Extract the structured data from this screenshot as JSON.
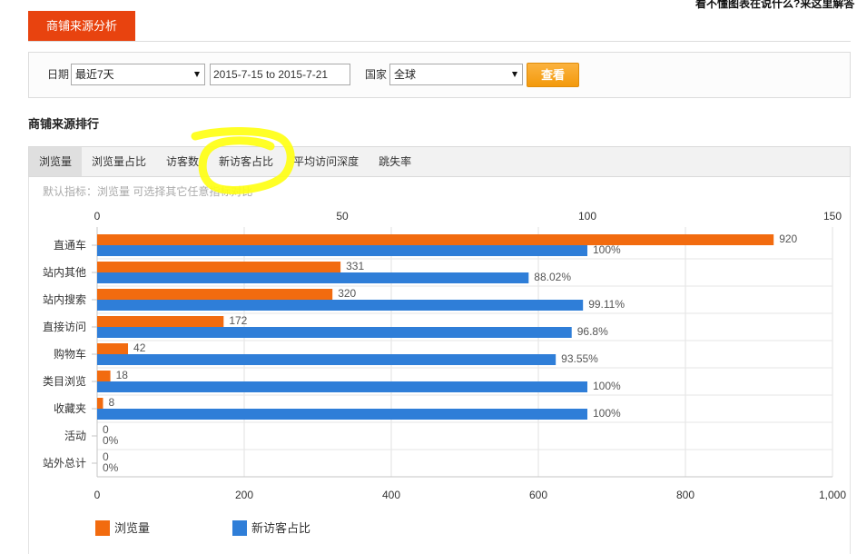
{
  "header": {
    "help_link": "看不懂图表在说什么?来这里解答",
    "tab_label": "商铺来源分析"
  },
  "filters": {
    "date_label": "日期",
    "date_range_select": "最近7天",
    "date_range_value": "2015-7-15 to 2015-7-21",
    "country_label": "国家",
    "country_select": "全球",
    "submit_label": "查看"
  },
  "section": {
    "title": "商铺来源排行",
    "hint": "默认指标：浏览量 可选择其它任意指标对比"
  },
  "metric_tabs": [
    {
      "label": "浏览量",
      "active": true
    },
    {
      "label": "浏览量占比",
      "active": false
    },
    {
      "label": "访客数",
      "active": false
    },
    {
      "label": "新访客占比",
      "active": false
    },
    {
      "label": "平均访问深度",
      "active": false
    },
    {
      "label": "跳失率",
      "active": false
    }
  ],
  "icons": {
    "select_caret": "caret-down-icon"
  },
  "colors": {
    "header_tab": "#e8430f",
    "submit_button": "#f7a41f",
    "annotation_highlight": "#ffff14"
  },
  "chart_data": {
    "type": "bar",
    "orientation": "horizontal",
    "categories": [
      "直通车",
      "站内其他",
      "站内搜索",
      "直接访问",
      "购物车",
      "类目浏览",
      "收藏夹",
      "活动",
      "站外总计"
    ],
    "series": [
      {
        "name": "浏览量",
        "axis": "bottom",
        "color": "#f26b0f",
        "values": [
          920,
          331,
          320,
          172,
          42,
          18,
          8,
          0,
          0
        ],
        "labels": [
          "920",
          "331",
          "320",
          "172",
          "42",
          "18",
          "8",
          "0",
          "0"
        ]
      },
      {
        "name": "新访客占比",
        "axis": "top",
        "color": "#2f7ed8",
        "values": [
          100,
          88.02,
          99.11,
          96.8,
          93.55,
          100,
          100,
          0,
          0
        ],
        "labels": [
          "100%",
          "88.02%",
          "99.11%",
          "96.8%",
          "93.55%",
          "100%",
          "100%",
          "0%",
          "0%"
        ]
      }
    ],
    "axes": {
      "top": {
        "range": [
          0,
          150
        ],
        "ticks": [
          0,
          50,
          100,
          150
        ],
        "tick_labels": [
          "0",
          "50",
          "100",
          "150"
        ]
      },
      "bottom": {
        "range": [
          0,
          1000
        ],
        "ticks": [
          0,
          200,
          400,
          600,
          800,
          1000
        ],
        "tick_labels": [
          "0",
          "200",
          "400",
          "600",
          "800",
          "1,000"
        ]
      }
    },
    "grid": true,
    "legend": "bottom-left"
  }
}
